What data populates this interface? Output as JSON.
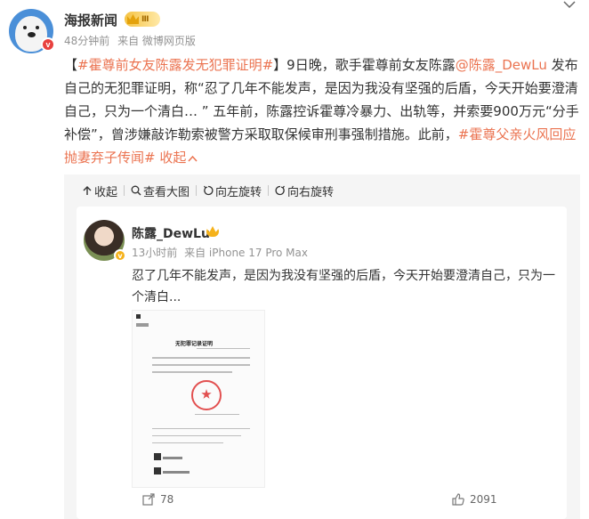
{
  "post": {
    "author": "海报新闻",
    "rank_label": "Ⅲ",
    "time": "48分钟前",
    "source": "来自 微博网页版",
    "verified_mark": "v",
    "text": {
      "bracket_open": "【",
      "tag1": "#霍尊前女友陈露发无犯罪证明#",
      "bracket_close": "】",
      "p1": "9日晚，歌手霍尊前女友陈露",
      "mention": "@陈露_DewLu",
      "p2": " 发布自己的无犯罪证明，称“忍了几年不能发声，是因为我没有坚强的后盾，今天开始要澄清自己，只为一个清白… ” 五年前，陈露控诉霍尊冷暴力、出轨等，并索要900万元“分手补偿”，曾涉嫌敲诈勒索被警方采取取保候审刑事强制措施。此前，",
      "tag2": "#霍尊父亲火风回应抛妻弃子传闻#",
      "collapse": " 收起"
    }
  },
  "toolbar": {
    "collapse_label": "收起",
    "view_large_label": "查看大图",
    "rotate_left_label": "向左旋转",
    "rotate_right_label": "向右旋转"
  },
  "repost": {
    "author": "陈露_DewLu",
    "time": "13小时前",
    "source": "来自 iPhone 17 Pro Max",
    "verified_mark": "v",
    "text": "忍了几年不能发声，是因为我没有坚强的后盾，今天开始要澄清自己，只为一个清白...",
    "doc_title": "无犯罪记录证明",
    "shares": "78",
    "likes": "2091"
  },
  "icons": {
    "top_chevron": "chevron-down-icon",
    "share": "share-icon",
    "like": "thumbs-up-icon"
  },
  "colors": {
    "accent": "#eb7350",
    "verified_red": "#e8413f",
    "verified_yellow": "#f5b21b",
    "card_bg": "#f5f5f5"
  }
}
